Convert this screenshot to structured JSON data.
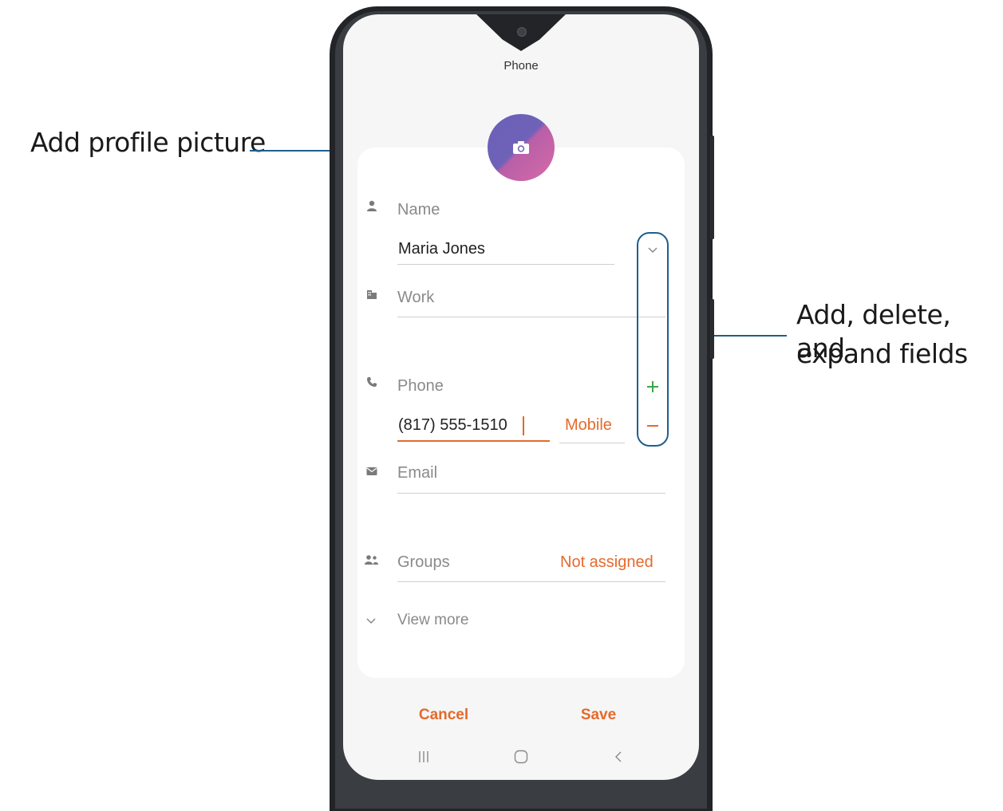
{
  "callouts": {
    "profile_picture": "Add profile picture",
    "fields_line1": "Add, delete, and",
    "fields_line2": "expand fields"
  },
  "screen": {
    "title": "Phone"
  },
  "form": {
    "name_label": "Name",
    "name_value": "Maria Jones",
    "work_placeholder": "Work",
    "phone_label": "Phone",
    "phone_value": "(817) 555-1510",
    "phone_type": "Mobile",
    "email_placeholder": "Email",
    "groups_label": "Groups",
    "groups_value": "Not assigned",
    "view_more": "View more"
  },
  "actions": {
    "cancel": "Cancel",
    "save": "Save"
  },
  "icons": {
    "camera": "camera-icon",
    "person": "person-icon",
    "work": "building-icon",
    "phone": "phone-icon",
    "email": "envelope-icon",
    "groups": "group-icon",
    "expand": "chevron-down-icon",
    "add": "plus-icon",
    "remove": "minus-icon",
    "nav_recents": "recents-icon",
    "nav_home": "home-icon",
    "nav_back": "back-icon"
  },
  "colors": {
    "accent": "#e46a2c",
    "add": "#3aa84a",
    "callout": "#1f5f8b"
  }
}
